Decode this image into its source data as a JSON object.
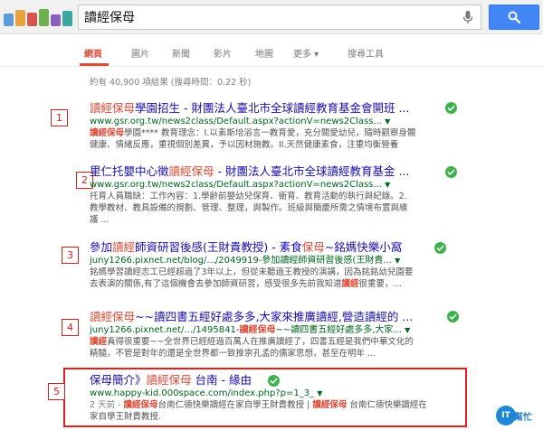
{
  "search": {
    "query": "讀經保母"
  },
  "tabs": [
    {
      "label": "網頁",
      "active": true
    },
    {
      "label": "圖片"
    },
    {
      "label": "新聞"
    },
    {
      "label": "影片"
    },
    {
      "label": "地圖"
    },
    {
      "label": "更多 ▾"
    },
    {
      "label": "搜尋工具"
    }
  ],
  "stats": "約有 40,900 項結果 (搜尋時間：0.22 秒)",
  "results": [
    {
      "number": "1",
      "title_hl": "讀經保母",
      "title_rest": "學園招生 - 財團法人臺北市全球讀經教育基金會開班 ...",
      "url": "www.gsr.org.tw/news2class/Default.aspx?actionV=news2Class...",
      "snippet1_hl": "讀經保母",
      "snippet1_rest": "學園**** 教育理念：I.以素斯培浴言一教育愛，充分關愛幼兒，隨時觀察身體",
      "snippet2": "健康、情緒反應，重視個別差異，予以因材施教。II.天然健康素食，注重均衡營養"
    },
    {
      "number": "2",
      "title_pre": "里仁托嬰中心徵",
      "title_hl": "讀經保母",
      "title_rest": " - 財團法人臺北市全球讀經教育基金 ...",
      "url": "www.gsr.org.tw/news2class/Default.aspx?actionV=news2Class...",
      "snippet1": "托育人員職缺：工作內容：1.學齡前嬰幼兒保育、衛育、教育活動的執行與紀錄。2.",
      "snippet2": "教學教材、教具設備的規劃、管理、整理，與製作。班級與簡慶所需之情境布置與維",
      "snippet3": "護 ..."
    },
    {
      "number": "3",
      "title_pre": "參加",
      "title_hl": "讀經",
      "title_mid": "師資研習後感(王財貴教授) - 素食",
      "title_hl2": "保母",
      "title_rest": "~銘媽快樂小窩",
      "url": "juny1266.pixnet.net/blog/.../2049919-參加讀經師資研習後感(王財貴...",
      "snippet1": "銘媽學習讀經志工已經超過了3年以上，但從未聽過王教授的演講，因為銘銘幼兒園要",
      "snippet2_pre": "去表演的關係,有了這個機會去參加師資研習，感受很多先前我知道",
      "snippet2_hl": "讀經",
      "snippet2_rest": "很重要，..."
    },
    {
      "number": "4",
      "title_hl": "讀經保母",
      "title_rest": "~~讀四書五經好處多多,大家來推廣讀經,營造讀經的 ...",
      "url_pre": "juny1266.pixnet.net/.../1495841-",
      "url_hl": "讀經保母",
      "url_rest": "~~讀四書五經好處多多,大家...",
      "snippet1_pre": "",
      "snippet1_hl": "讀經",
      "snippet1_rest": "真得很重要~~全世界已經經過百萬人在推廣讀經了，四書五經是我們中華文化的",
      "snippet2": "精髓，不管是對年的還是全世界都一致推崇孔孟的儒家思想，甚至在明年 ..."
    },
    {
      "number": "5",
      "title_pre": "保母簡介》",
      "title_hl": "讀經保母",
      "title_rest": " 台南 - 緣由",
      "url": "www.happy-kid.000space.com/index.php?p=1_3_",
      "snippet1_date": "2 天前 - ",
      "snippet1_hl": "讀經保母",
      "snippet1_mid": "台南仁德快樂讀經在家自學王財貴教授 | ",
      "snippet1_hl2": "讀經保母",
      "snippet1_rest": " 台南仁德快樂讀經在",
      "snippet2": "家自學王財貴教授."
    }
  ],
  "watermark": {
    "circle": "IT",
    "text": "幫忙"
  },
  "colors": {
    "accent_red": "#dd4b39",
    "link": "#1a0dab",
    "url_green": "#006621",
    "search_blue": "#4285f4",
    "annotation_red": "#e1211f"
  }
}
